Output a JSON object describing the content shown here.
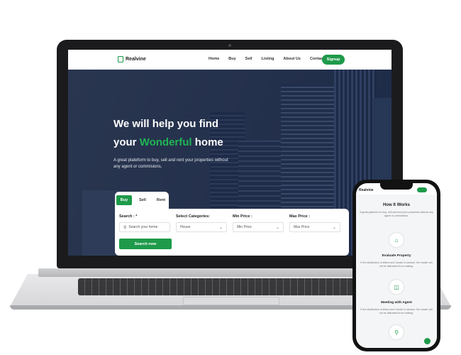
{
  "site": {
    "brand": "Realvine",
    "nav": [
      "Home",
      "Buy",
      "Sell",
      "Listing",
      "About Us",
      "Contact"
    ],
    "signup": "Signup"
  },
  "hero": {
    "line1": "We will help you find",
    "line2_pre": "your",
    "line2_accent": "Wonderful",
    "line2_post": "home",
    "subtitle": "A great plateform to buy, sell and rent your properties without any agent or commisions."
  },
  "search": {
    "tabs": [
      "Buy",
      "Sell",
      "Rent"
    ],
    "active_tab": "Buy",
    "fields": [
      {
        "label": "Search : *",
        "value": "Search your home"
      },
      {
        "label": "Select Categories:",
        "value": "House"
      },
      {
        "label": "Min Price :",
        "value": "Min Price"
      },
      {
        "label": "Max Price :",
        "value": "Max Price"
      }
    ],
    "button": "Search now"
  },
  "mobile": {
    "brand": "Realvine",
    "section_title": "How It Works",
    "intro": "A great plateform to buy, sell and rent your properties without any agent or commisions.",
    "steps": [
      {
        "title": "Evaluate Property",
        "text": "If the distribution of letters and 'words' is random, the reader will not be distracted from making.",
        "icon": "home-icon"
      },
      {
        "title": "Meeting with Agent",
        "text": "If the distribution of letters and 'words' is random, the reader will not be distracted from making.",
        "icon": "briefcase-icon"
      }
    ]
  },
  "colors": {
    "accent": "#1e9a4a",
    "hero_overlay": "#2b3a56"
  }
}
